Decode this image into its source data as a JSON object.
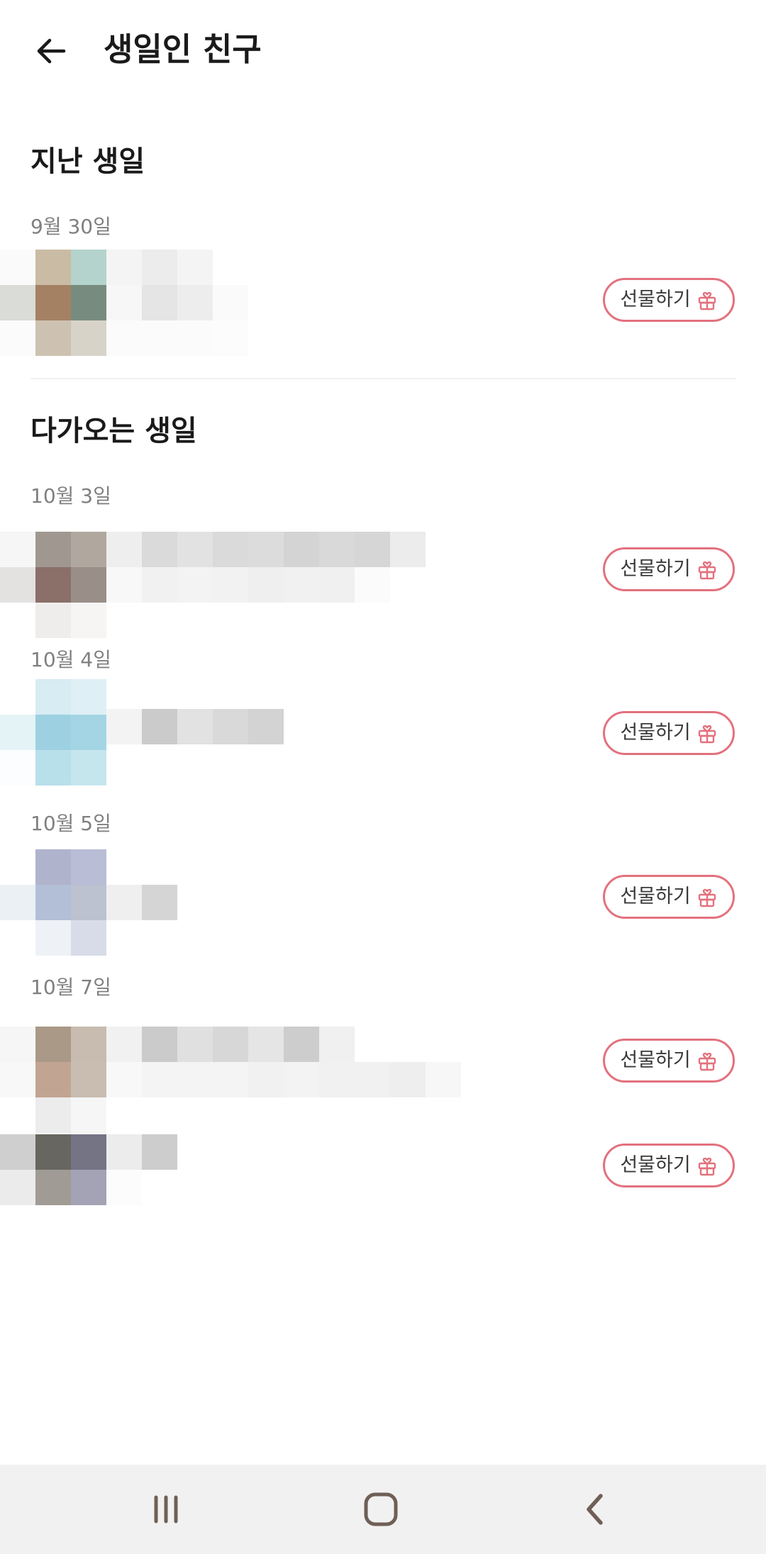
{
  "header": {
    "title": "생일인 친구",
    "back_icon": "arrow-left-icon"
  },
  "sections": [
    {
      "title": "지난 생일",
      "groups": [
        {
          "date": "9월 30일"
        }
      ]
    },
    {
      "title": "다가오는 생일",
      "groups": [
        {
          "date": "10월 3일"
        },
        {
          "date": "10월 4일"
        },
        {
          "date": "10월 5일"
        },
        {
          "date": "10월 7일"
        }
      ]
    }
  ],
  "gift_button": {
    "label": "선물하기",
    "icon": "gift-heart-icon"
  },
  "navbar": {
    "recents_icon": "recents-icon",
    "home_icon": "home-icon",
    "back_icon": "nav-back-icon"
  },
  "colors": {
    "accent": "#e3717d",
    "muted_text": "#808080",
    "navbar_bg": "#f2f1f1"
  }
}
